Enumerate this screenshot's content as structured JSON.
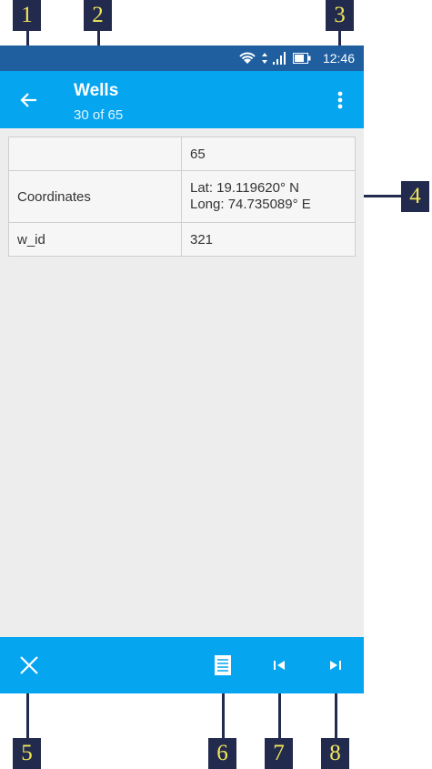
{
  "status_bar": {
    "time": "12:46"
  },
  "app_bar": {
    "title": "Wells",
    "subtitle": "30 of 65"
  },
  "properties": [
    {
      "key": "",
      "value_lines": [
        "65"
      ]
    },
    {
      "key": "Coordinates",
      "value_lines": [
        "Lat: 19.119620° N",
        "Long: 74.735089° E"
      ]
    },
    {
      "key": "w_id",
      "value_lines": [
        "321"
      ]
    }
  ],
  "callouts": [
    "1",
    "2",
    "3",
    "4",
    "5",
    "6",
    "7",
    "8"
  ],
  "colors": {
    "app_bar": "#05a5f0",
    "status_bar": "#1f5fa0",
    "callout_bg": "#222a4d",
    "callout_text": "#f2e65a"
  },
  "icons": {
    "back": "arrow-left-icon",
    "overflow": "more-vert-icon",
    "close": "close-icon",
    "list": "list-icon",
    "first": "skip-first-icon",
    "last": "skip-last-icon"
  }
}
